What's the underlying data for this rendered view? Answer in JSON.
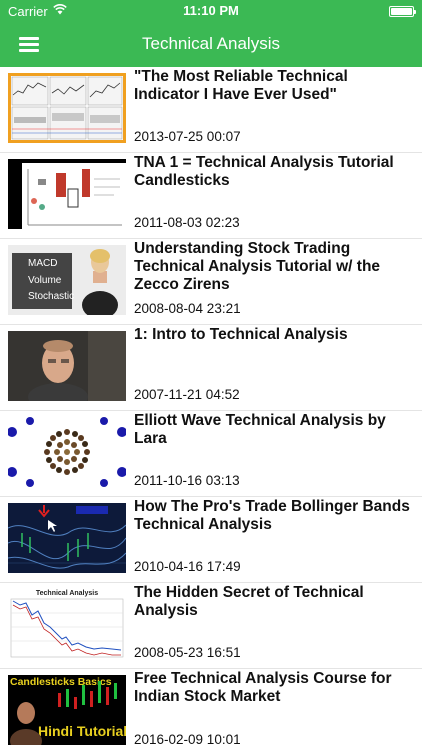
{
  "status": {
    "carrier": "Carrier",
    "time": "11:10 PM"
  },
  "nav": {
    "title": "Technical Analysis",
    "menu_icon": "hamburger-menu-icon"
  },
  "colors": {
    "accent": "#3bb954"
  },
  "videos": [
    {
      "title": "\"The Most Reliable Technical Indicator I Have Ever Used\"",
      "date": "2013-07-25 00:07"
    },
    {
      "title": "TNA 1 = Technical Analysis Tutorial Candlesticks",
      "date": "2011-08-03 02:23"
    },
    {
      "title": "Understanding Stock Trading Technical Analysis Tutorial w/ the Zecco Zirens",
      "date": "2008-08-04 23:21",
      "thumb_text": [
        "MACD",
        "Volume",
        "Stochastic"
      ]
    },
    {
      "title": "1: Intro to Technical Analysis",
      "date": "2007-11-21 04:52"
    },
    {
      "title": "Elliott Wave Technical Analysis by Lara",
      "date": "2011-10-16 03:13"
    },
    {
      "title": "How The Pro's Trade Bollinger Bands Technical Analysis",
      "date": "2010-04-16 17:49"
    },
    {
      "title": "The Hidden Secret of Technical Analysis",
      "date": "2008-05-23 16:51",
      "thumb_text": [
        "Technical Analysis"
      ]
    },
    {
      "title": "Free Technical Analysis Course for Indian Stock Market",
      "date": "2016-02-09 10:01",
      "thumb_text": [
        "Candlesticks Basics",
        "Hindi Tutorial"
      ]
    }
  ]
}
